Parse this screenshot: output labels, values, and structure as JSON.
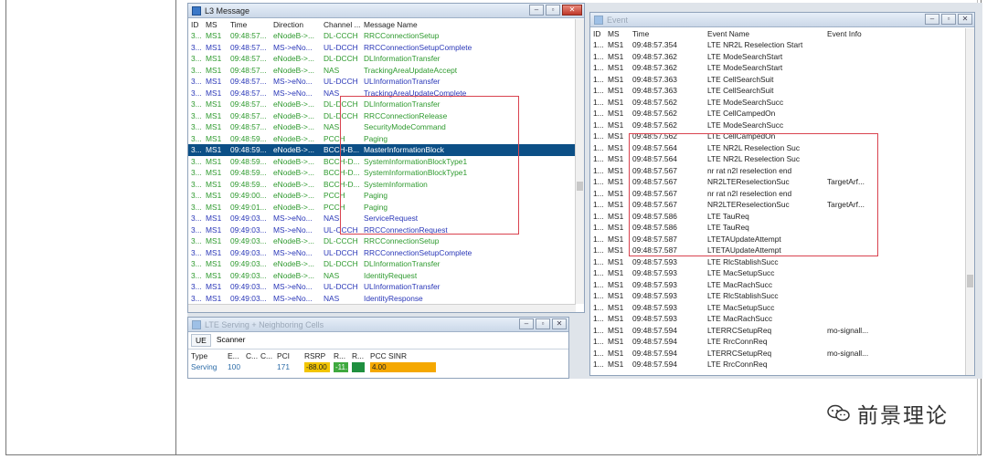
{
  "l3": {
    "title": "L3 Message",
    "columns": [
      "ID",
      "MS",
      "Time",
      "Direction",
      "Channel ...",
      "Message Name"
    ],
    "rows": [
      {
        "id": "3...",
        "ms": "MS1",
        "time": "09:48:57...",
        "dir": "eNodeB->...",
        "ch": "DL-CCCH",
        "msg": "RRCConnectionSetup",
        "type": "dl"
      },
      {
        "id": "3...",
        "ms": "MS1",
        "time": "09:48:57...",
        "dir": "MS->eNo...",
        "ch": "UL-DCCH",
        "msg": "RRCConnectionSetupComplete",
        "type": "ul"
      },
      {
        "id": "3...",
        "ms": "MS1",
        "time": "09:48:57...",
        "dir": "eNodeB->...",
        "ch": "DL-DCCH",
        "msg": "DLInformationTransfer",
        "type": "dl"
      },
      {
        "id": "3...",
        "ms": "MS1",
        "time": "09:48:57...",
        "dir": "eNodeB->...",
        "ch": "NAS",
        "msg": "TrackingAreaUpdateAccept",
        "type": "dl"
      },
      {
        "id": "3...",
        "ms": "MS1",
        "time": "09:48:57...",
        "dir": "MS->eNo...",
        "ch": "UL-DCCH",
        "msg": "ULInformationTransfer",
        "type": "ul"
      },
      {
        "id": "3...",
        "ms": "MS1",
        "time": "09:48:57...",
        "dir": "MS->eNo...",
        "ch": "NAS",
        "msg": "TrackingAreaUpdateComplete",
        "type": "ul"
      },
      {
        "id": "3...",
        "ms": "MS1",
        "time": "09:48:57...",
        "dir": "eNodeB->...",
        "ch": "DL-DCCH",
        "msg": "DLInformationTransfer",
        "type": "dl"
      },
      {
        "id": "3...",
        "ms": "MS1",
        "time": "09:48:57...",
        "dir": "eNodeB->...",
        "ch": "DL-DCCH",
        "msg": "RRCConnectionRelease",
        "type": "dl"
      },
      {
        "id": "3...",
        "ms": "MS1",
        "time": "09:48:57...",
        "dir": "eNodeB->...",
        "ch": "NAS",
        "msg": "SecurityModeCommand",
        "type": "dl"
      },
      {
        "id": "3...",
        "ms": "MS1",
        "time": "09:48:59...",
        "dir": "eNodeB->...",
        "ch": "PCCH",
        "msg": "Paging",
        "type": "dl"
      },
      {
        "id": "3...",
        "ms": "MS1",
        "time": "09:48:59...",
        "dir": "eNodeB->...",
        "ch": "BCCH-B...",
        "msg": "MasterInformationBlock",
        "type": "hl"
      },
      {
        "id": "3...",
        "ms": "MS1",
        "time": "09:48:59...",
        "dir": "eNodeB->...",
        "ch": "BCCH-D...",
        "msg": "SystemInformationBlockType1",
        "type": "dl"
      },
      {
        "id": "3...",
        "ms": "MS1",
        "time": "09:48:59...",
        "dir": "eNodeB->...",
        "ch": "BCCH-D...",
        "msg": "SystemInformationBlockType1",
        "type": "dl"
      },
      {
        "id": "3...",
        "ms": "MS1",
        "time": "09:48:59...",
        "dir": "eNodeB->...",
        "ch": "BCCH-D...",
        "msg": "SystemInformation",
        "type": "dl"
      },
      {
        "id": "3...",
        "ms": "MS1",
        "time": "09:49:00...",
        "dir": "eNodeB->...",
        "ch": "PCCH",
        "msg": "Paging",
        "type": "dl"
      },
      {
        "id": "3...",
        "ms": "MS1",
        "time": "09:49:01...",
        "dir": "eNodeB->...",
        "ch": "PCCH",
        "msg": "Paging",
        "type": "dl"
      },
      {
        "id": "3...",
        "ms": "MS1",
        "time": "09:49:03...",
        "dir": "MS->eNo...",
        "ch": "NAS",
        "msg": "ServiceRequest",
        "type": "ul"
      },
      {
        "id": "3...",
        "ms": "MS1",
        "time": "09:49:03...",
        "dir": "MS->eNo...",
        "ch": "UL-CCCH",
        "msg": "RRCConnectionRequest",
        "type": "ul"
      },
      {
        "id": "3...",
        "ms": "MS1",
        "time": "09:49:03...",
        "dir": "eNodeB->...",
        "ch": "DL-CCCH",
        "msg": "RRCConnectionSetup",
        "type": "dl"
      },
      {
        "id": "3...",
        "ms": "MS1",
        "time": "09:49:03...",
        "dir": "MS->eNo...",
        "ch": "UL-DCCH",
        "msg": "RRCConnectionSetupComplete",
        "type": "ul"
      },
      {
        "id": "3...",
        "ms": "MS1",
        "time": "09:49:03...",
        "dir": "eNodeB->...",
        "ch": "DL-DCCH",
        "msg": "DLInformationTransfer",
        "type": "dl"
      },
      {
        "id": "3...",
        "ms": "MS1",
        "time": "09:49:03...",
        "dir": "eNodeB->...",
        "ch": "NAS",
        "msg": "IdentityRequest",
        "type": "dl"
      },
      {
        "id": "3...",
        "ms": "MS1",
        "time": "09:49:03...",
        "dir": "MS->eNo...",
        "ch": "UL-DCCH",
        "msg": "ULInformationTransfer",
        "type": "ul"
      },
      {
        "id": "3...",
        "ms": "MS1",
        "time": "09:49:03...",
        "dir": "MS->eNo...",
        "ch": "NAS",
        "msg": "IdentityResponse",
        "type": "ul"
      }
    ]
  },
  "event": {
    "title": "Event",
    "columns": [
      "ID",
      "MS",
      "Time",
      "Event Name",
      "Event Info"
    ],
    "rows": [
      {
        "id": "1...",
        "ms": "MS1",
        "time": "09:48:57.354",
        "name": "LTE NR2L Reselection Start",
        "info": ""
      },
      {
        "id": "1...",
        "ms": "MS1",
        "time": "09:48:57.362",
        "name": "LTE ModeSearchStart",
        "info": ""
      },
      {
        "id": "1...",
        "ms": "MS1",
        "time": "09:48:57.362",
        "name": "LTE ModeSearchStart",
        "info": ""
      },
      {
        "id": "1...",
        "ms": "MS1",
        "time": "09:48:57.363",
        "name": "LTE CellSearchSuit",
        "info": ""
      },
      {
        "id": "1...",
        "ms": "MS1",
        "time": "09:48:57.363",
        "name": "LTE CellSearchSuit",
        "info": ""
      },
      {
        "id": "1...",
        "ms": "MS1",
        "time": "09:48:57.562",
        "name": "LTE ModeSearchSucc",
        "info": ""
      },
      {
        "id": "1...",
        "ms": "MS1",
        "time": "09:48:57.562",
        "name": "LTE CellCampedOn",
        "info": ""
      },
      {
        "id": "1...",
        "ms": "MS1",
        "time": "09:48:57.562",
        "name": "LTE ModeSearchSucc",
        "info": ""
      },
      {
        "id": "1...",
        "ms": "MS1",
        "time": "09:48:57.562",
        "name": "LTE CellCampedOn",
        "info": ""
      },
      {
        "id": "1...",
        "ms": "MS1",
        "time": "09:48:57.564",
        "name": "LTE NR2L Reselection Suc",
        "info": ""
      },
      {
        "id": "1...",
        "ms": "MS1",
        "time": "09:48:57.564",
        "name": "LTE NR2L Reselection Suc",
        "info": ""
      },
      {
        "id": "1...",
        "ms": "MS1",
        "time": "09:48:57.567",
        "name": "nr rat n2l reselection end",
        "info": ""
      },
      {
        "id": "1...",
        "ms": "MS1",
        "time": "09:48:57.567",
        "name": "NR2LTEReselectionSuc",
        "info": "TargetArf..."
      },
      {
        "id": "1...",
        "ms": "MS1",
        "time": "09:48:57.567",
        "name": "nr rat n2l reselection end",
        "info": ""
      },
      {
        "id": "1...",
        "ms": "MS1",
        "time": "09:48:57.567",
        "name": "NR2LTEReselectionSuc",
        "info": "TargetArf..."
      },
      {
        "id": "1...",
        "ms": "MS1",
        "time": "09:48:57.586",
        "name": "LTE TauReq",
        "info": ""
      },
      {
        "id": "1...",
        "ms": "MS1",
        "time": "09:48:57.586",
        "name": "LTE TauReq",
        "info": ""
      },
      {
        "id": "1...",
        "ms": "MS1",
        "time": "09:48:57.587",
        "name": "LTETAUpdateAttempt",
        "info": ""
      },
      {
        "id": "1...",
        "ms": "MS1",
        "time": "09:48:57.587",
        "name": "LTETAUpdateAttempt",
        "info": ""
      },
      {
        "id": "1...",
        "ms": "MS1",
        "time": "09:48:57.593",
        "name": "LTE RlcStablishSucc",
        "info": ""
      },
      {
        "id": "1...",
        "ms": "MS1",
        "time": "09:48:57.593",
        "name": "LTE MacSetupSucc",
        "info": ""
      },
      {
        "id": "1...",
        "ms": "MS1",
        "time": "09:48:57.593",
        "name": "LTE MacRachSucc",
        "info": ""
      },
      {
        "id": "1...",
        "ms": "MS1",
        "time": "09:48:57.593",
        "name": "LTE RlcStablishSucc",
        "info": ""
      },
      {
        "id": "1...",
        "ms": "MS1",
        "time": "09:48:57.593",
        "name": "LTE MacSetupSucc",
        "info": ""
      },
      {
        "id": "1...",
        "ms": "MS1",
        "time": "09:48:57.593",
        "name": "LTE MacRachSucc",
        "info": ""
      },
      {
        "id": "1...",
        "ms": "MS1",
        "time": "09:48:57.594",
        "name": "LTERRCSetupReq",
        "info": "mo-signall..."
      },
      {
        "id": "1...",
        "ms": "MS1",
        "time": "09:48:57.594",
        "name": "LTE RrcConnReq",
        "info": ""
      },
      {
        "id": "1...",
        "ms": "MS1",
        "time": "09:48:57.594",
        "name": "LTERRCSetupReq",
        "info": "mo-signall..."
      },
      {
        "id": "1...",
        "ms": "MS1",
        "time": "09:48:57.594",
        "name": "LTE RrcConnReq",
        "info": ""
      }
    ]
  },
  "cells": {
    "title": "LTE Serving + Neighboring Cells",
    "tabs": [
      "UE",
      "Scanner"
    ],
    "columns": [
      "Type",
      "E...",
      "C...",
      "C...",
      "PCI",
      "RSRP",
      "R...",
      "R...",
      "PCC SINR"
    ],
    "row": {
      "type": "Serving",
      "e": "100",
      "c1": "",
      "c2": "",
      "pci": "171",
      "rsrp": "-88.00",
      "r1": "-11...",
      "r2": "",
      "sinr": "4.00"
    },
    "colors": {
      "rsrp": "#f2c500",
      "r1": "#3fa93f",
      "r2": "#1f8f3f",
      "sinr": "#f5a800"
    }
  },
  "watermark": {
    "text": "前景理论"
  },
  "colors": {
    "dl": "#2e9a2e",
    "ul": "#2a37b8",
    "highlight": "#0c4f86",
    "annotation": "#d9434f"
  }
}
